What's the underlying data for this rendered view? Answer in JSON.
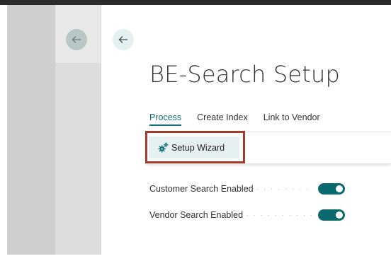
{
  "page": {
    "title": "BE-Search Setup"
  },
  "navigation": {
    "back_icon": "arrow-left-icon"
  },
  "tabs": [
    {
      "label": "Process",
      "active": true
    },
    {
      "label": "Create Index",
      "active": false
    },
    {
      "label": "Link to Vendor",
      "active": false
    }
  ],
  "actions": {
    "setup_wizard": {
      "label": "Setup Wizard",
      "icon": "gears-icon",
      "icon_color": "#0d6e73"
    }
  },
  "fields": [
    {
      "label": "Customer Search Enabled",
      "enabled": true
    },
    {
      "label": "Vendor Search Enabled",
      "enabled": true
    }
  ],
  "colors": {
    "accent": "#0d6e73",
    "highlight_border": "#a33a2a",
    "toggle_on": "#0b6a70"
  }
}
